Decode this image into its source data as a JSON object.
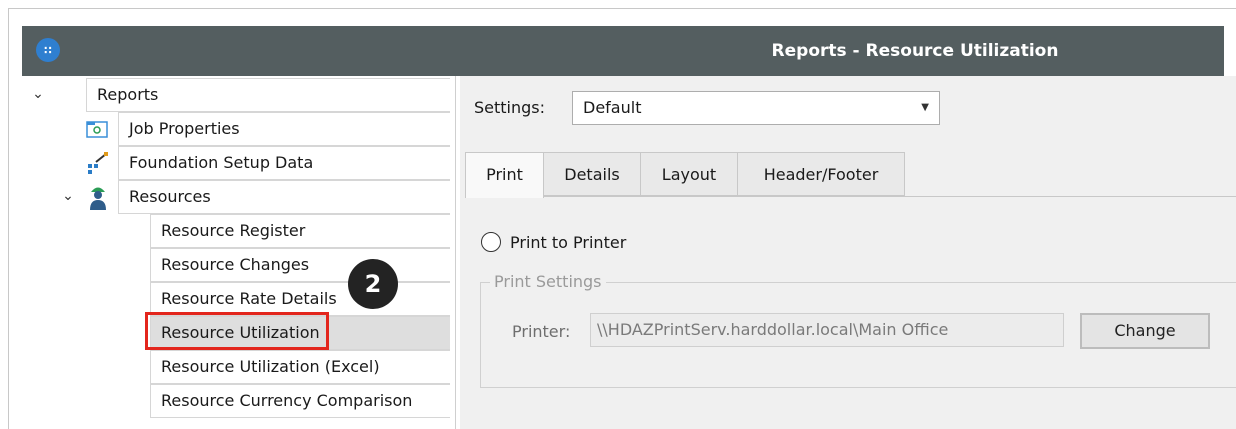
{
  "window": {
    "title": "Reports - Resource Utilization"
  },
  "tree": {
    "root": "Reports",
    "items": [
      {
        "label": "Job Properties",
        "icon": "folder-settings-icon"
      },
      {
        "label": "Foundation Setup Data",
        "icon": "setup-data-icon"
      },
      {
        "label": "Resources",
        "icon": "worker-icon"
      }
    ],
    "resources": [
      "Resource Register",
      "Resource Changes",
      "Resource Rate Details",
      "Resource Utilization",
      "Resource Utilization (Excel)",
      "Resource Currency Comparison"
    ],
    "selected": "Resource Utilization"
  },
  "annotation": {
    "step": "2",
    "highlight_color": "#e3261d"
  },
  "settings": {
    "label": "Settings:",
    "value": "Default"
  },
  "tabs": [
    "Print",
    "Details",
    "Layout",
    "Header/Footer"
  ],
  "print": {
    "radio_label": "Print to Printer",
    "group_label": "Print Settings",
    "printer_label": "Printer:",
    "printer_value": "\\\\HDAZPrintServ.harddollar.local\\Main Office",
    "change_label": "Change"
  },
  "colors": {
    "titlebar": "#545e60",
    "accent": "#2f7fd0"
  }
}
